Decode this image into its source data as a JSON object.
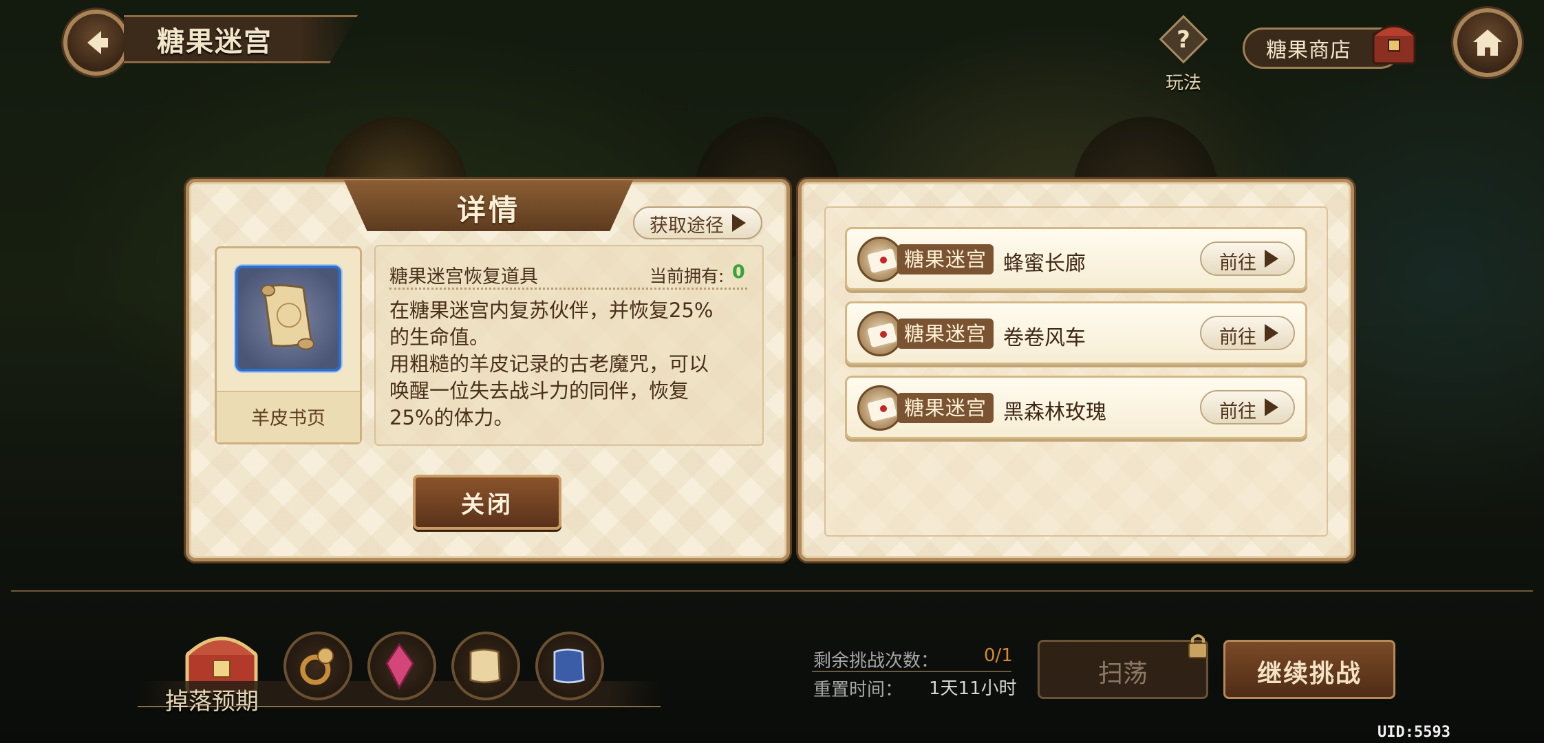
{
  "header": {
    "title": "糖果迷宫",
    "help_label": "玩法",
    "help_glyph": "?",
    "shop_label": "糖果商店"
  },
  "detail": {
    "tab_title": "详情",
    "obtain_label": "获取途径",
    "item_name": "羊皮书页",
    "item_title": "糖果迷宫恢复道具",
    "owned_label": "当前拥有:",
    "owned_value": "0",
    "description": "在糖果迷宫内复苏伙伴，并恢复25%\n的生命值。\n用粗糙的羊皮记录的古老魔咒，可以\n唤醒一位失去战斗力的同伴，恢复\n25%的体力。",
    "close_label": "关闭"
  },
  "sources": [
    {
      "tag": "糖果迷宫",
      "name": "蜂蜜长廊",
      "go_label": "前往"
    },
    {
      "tag": "糖果迷宫",
      "name": "卷卷风车",
      "go_label": "前往"
    },
    {
      "tag": "糖果迷宫",
      "name": "黑森林玫瑰",
      "go_label": "前往"
    }
  ],
  "bottom": {
    "drop_label": "掉落预期",
    "drops": [
      "ring-icon",
      "crystal-icon",
      "parchment-icon",
      "blue-scroll-icon"
    ],
    "remaining_label": "剩余挑战次数：",
    "remaining_value": "0/1",
    "reset_label": "重置时间：",
    "reset_value": "1天11小时",
    "sweep_label": "扫荡",
    "continue_label": "继续挑战",
    "uid": "UID:5593"
  },
  "colors": {
    "accent_brown": "#7a5432",
    "owned_green": "#37a43a",
    "remaining_orange": "#d98a2a",
    "item_border_blue": "#2f6fc9"
  }
}
